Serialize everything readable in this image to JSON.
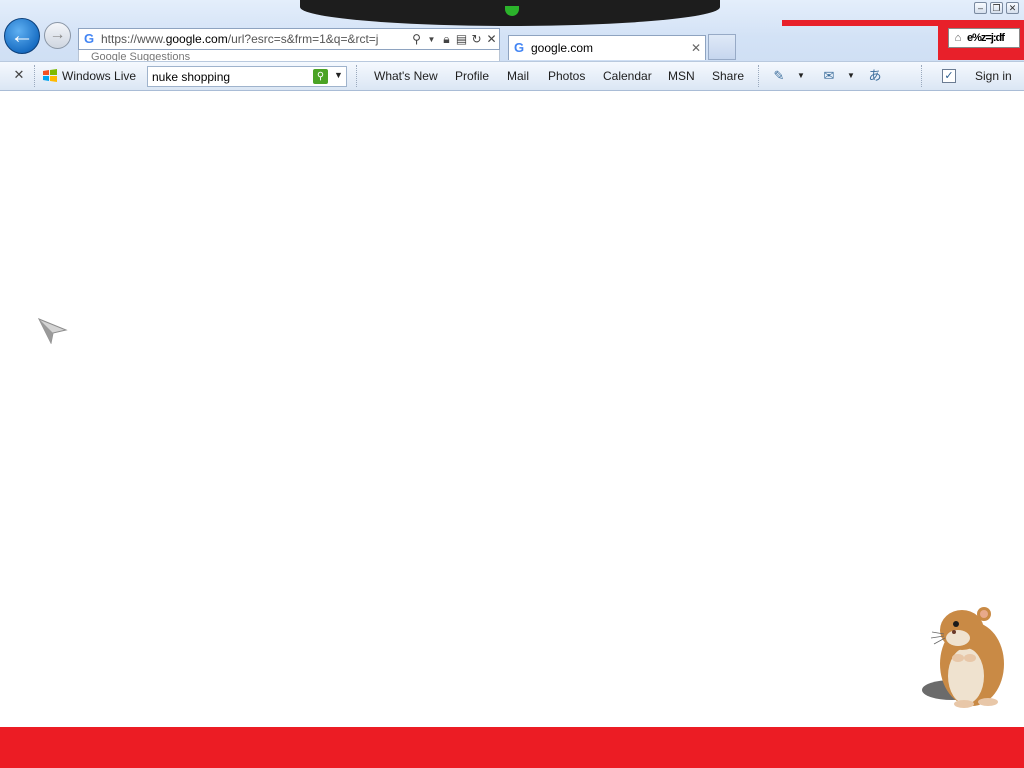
{
  "window": {
    "minimize_glyph": "–",
    "restore_glyph": "❐",
    "close_glyph": "✕"
  },
  "navigation": {
    "back_glyph": "←",
    "forward_glyph": "→"
  },
  "address_bar": {
    "url_prefix": "https://www.",
    "url_domain": "google.com",
    "url_rest": "/url?esrc=s&frm=1&q=&rct=j"
  },
  "suggestions": {
    "label": "Google Suggestions"
  },
  "tab": {
    "title": "google.com",
    "close_glyph": "✕"
  },
  "home_area": {
    "glitch_text": "e%z=j:df"
  },
  "toolbar": {
    "close_glyph": "✕",
    "brand_label": "Windows Live",
    "search_value": "nuke shopping",
    "links": [
      "What's New",
      "Profile",
      "Mail",
      "Photos",
      "Calendar",
      "MSN",
      "Share"
    ],
    "sign_in": "Sign in"
  },
  "icons": {
    "search": "search-icon",
    "lock": "lock-icon",
    "compat": "compatibility-view-icon",
    "refresh": "refresh-icon",
    "stop": "stop-icon",
    "home": "home-icon",
    "favorite_add": "add-favorite-icon",
    "mail": "mail-icon",
    "translate": "translate-icon",
    "checkbox": "checkbox-icon",
    "cursor": "cursor-icon",
    "hamster": "hamster-mascot"
  },
  "colors": {
    "accent_red": "#ec1c24",
    "live_green": "#4aa324",
    "back_blue": "#1a6fc4"
  }
}
